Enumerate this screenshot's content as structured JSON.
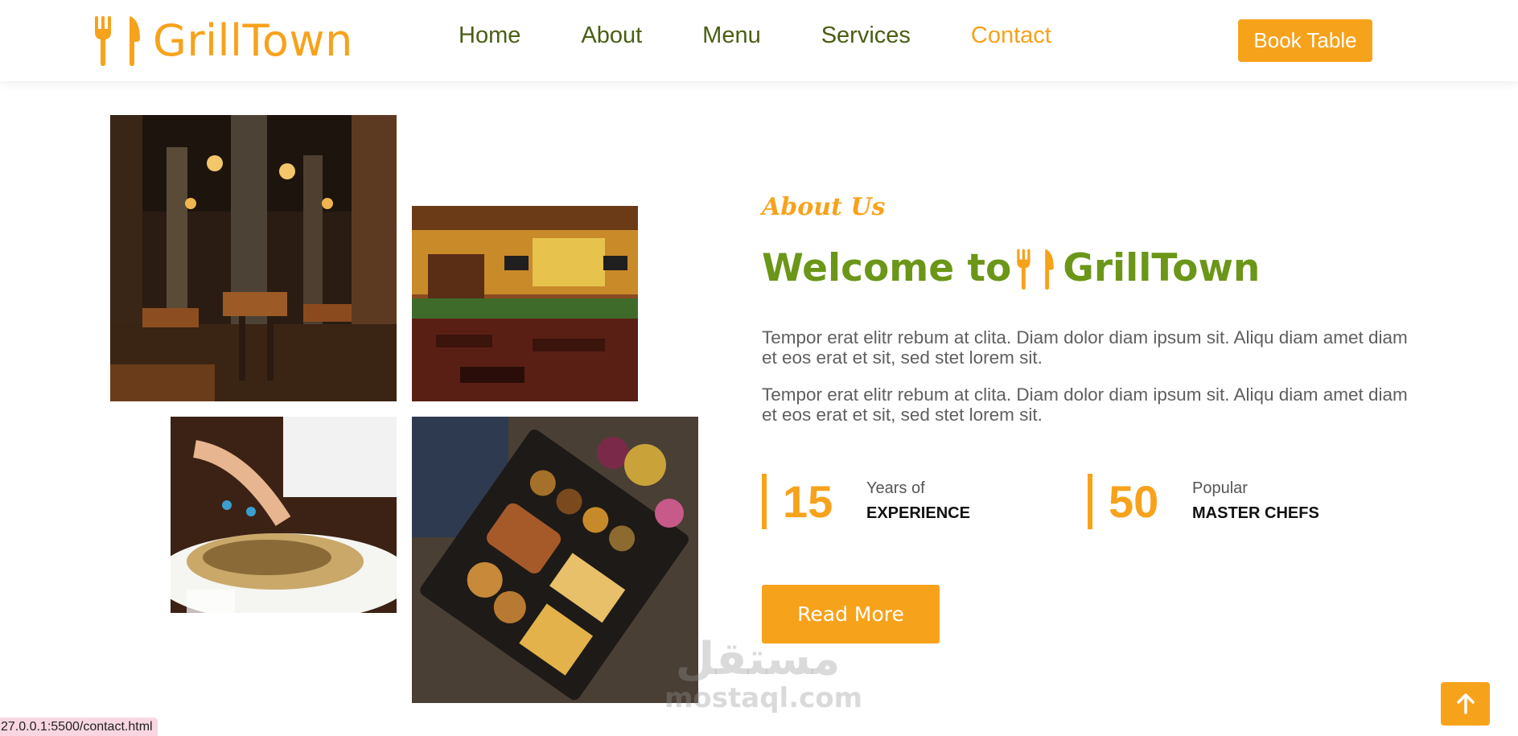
{
  "brand": {
    "name": "GrillTown",
    "icon": "fork-knife-icon"
  },
  "nav": {
    "items": [
      {
        "label": "Home",
        "active": false
      },
      {
        "label": "About",
        "active": false
      },
      {
        "label": "Menu",
        "active": false
      },
      {
        "label": "Services",
        "active": false
      },
      {
        "label": "Contact",
        "active": true
      }
    ],
    "book_button": "Book Table"
  },
  "about": {
    "section_label": "About Us",
    "welcome_prefix": "Welcome to",
    "welcome_brand": "GrillTown",
    "paragraphs": [
      "Tempor erat elitr rebum at clita. Diam dolor diam ipsum sit. Aliqu diam amet diam et eos erat et sit, sed stet lorem sit.",
      "Tempor erat elitr rebum at clita. Diam dolor diam ipsum sit. Aliqu diam amet diam et eos erat et sit, sed stet lorem sit."
    ],
    "stats": [
      {
        "number": "15",
        "top": "Years of",
        "bottom": "EXPERIENCE"
      },
      {
        "number": "50",
        "top": "Popular",
        "bottom": "MASTER CHEFS"
      }
    ],
    "read_more": "Read More"
  },
  "photos": [
    {
      "name": "restaurant-interior-dark"
    },
    {
      "name": "restaurant-interior-bright"
    },
    {
      "name": "salad-plate"
    },
    {
      "name": "grill-platter"
    }
  ],
  "watermark": {
    "arabic": "مستقل",
    "domain": "mostaql.com"
  },
  "back_to_top_icon": "arrow-up-icon",
  "status_url": "27.0.0.1:5500/contact.html",
  "colors": {
    "accent": "#f7a21b",
    "heading_green": "#6b9618",
    "nav_text": "#4a5e12"
  }
}
